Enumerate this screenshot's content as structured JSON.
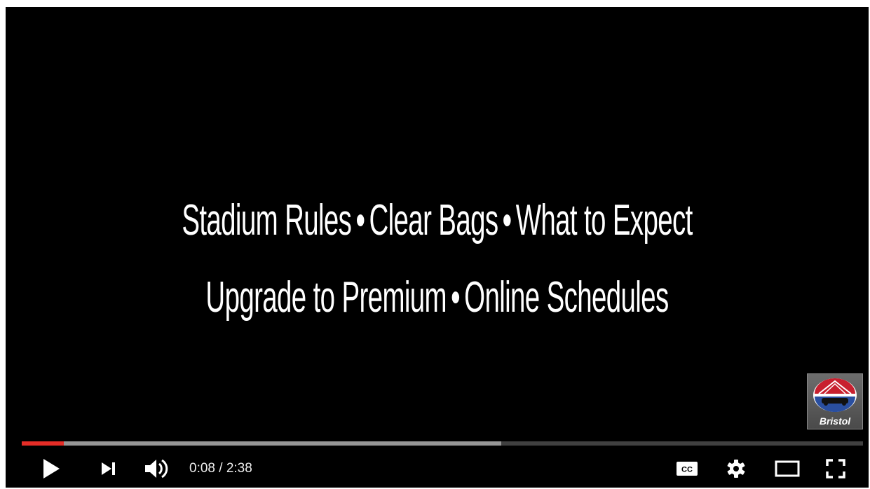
{
  "video": {
    "title_line_1": [
      "Stadium Rules",
      "Clear Bags",
      "What to Expect"
    ],
    "title_line_2": [
      "Upgrade to Premium",
      "Online Schedules"
    ],
    "bullet": "•"
  },
  "watermark": {
    "label": "Bristol",
    "icon": "bristol-logo-icon"
  },
  "progress": {
    "played_fraction": 0.05,
    "buffered_fraction": 0.57,
    "played_color": "#e52d27"
  },
  "controls": {
    "current_time": "0:08",
    "separator": " / ",
    "duration": "2:38",
    "cc_label": "CC",
    "icons": [
      "play-icon",
      "next-icon",
      "volume-icon",
      "cc-icon",
      "settings-icon",
      "theater-icon",
      "fullscreen-icon"
    ]
  }
}
